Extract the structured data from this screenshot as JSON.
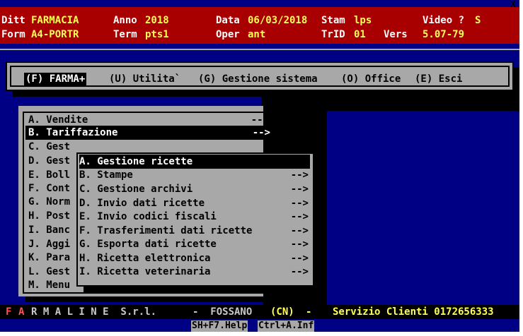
{
  "header": {
    "row1": {
      "ditt_label": "Ditt",
      "ditt_value": "FARMACIA",
      "anno_label": "Anno",
      "anno_value": "2018",
      "data_label": "Data",
      "data_value": "06/03/2018",
      "stam_label": "Stam",
      "stam_value": "lps",
      "video_label": "Video ?",
      "video_value": "S"
    },
    "row2": {
      "form_label": "Form",
      "form_value": "A4-PORTR",
      "term_label": "Term",
      "term_value": "pts1",
      "oper_label": "Oper",
      "oper_value": "ant",
      "trid_label": "TrID",
      "trid_value": "01",
      "vers_label": "Vers",
      "vers_value": "5.07-79"
    }
  },
  "close_glyph": "X",
  "menubar": {
    "items": [
      {
        "label": "(F) FARMA+",
        "selected": true
      },
      {
        "label": "(U) Utilita`",
        "selected": false
      },
      {
        "label": "(G) Gestione sistema",
        "selected": false
      },
      {
        "label": "(O) Office",
        "selected": false
      },
      {
        "label": "(E) Esci",
        "selected": false
      }
    ]
  },
  "menu1": {
    "items": [
      {
        "label": "A. Vendite",
        "arrow": "-->"
      },
      {
        "label": "B. Tariffazione",
        "arrow": "-->",
        "selected": true
      },
      {
        "label": "C. Gest",
        "arrow": ""
      },
      {
        "label": "D. Gest",
        "arrow": ""
      },
      {
        "label": "E. Boll",
        "arrow": ""
      },
      {
        "label": "F. Cont",
        "arrow": ""
      },
      {
        "label": "G. Norm",
        "arrow": ""
      },
      {
        "label": "H. Post",
        "arrow": ""
      },
      {
        "label": "I. Banc",
        "arrow": ""
      },
      {
        "label": "J. Aggi",
        "arrow": ""
      },
      {
        "label": "K. Para",
        "arrow": ""
      },
      {
        "label": "L. Gest",
        "arrow": ""
      },
      {
        "label": "M. Menu",
        "arrow": ""
      }
    ]
  },
  "menu2": {
    "items": [
      {
        "label": "A. Gestione ricette",
        "arrow": "",
        "selected": true
      },
      {
        "label": "B. Stampe",
        "arrow": "-->"
      },
      {
        "label": "C. Gestione archivi",
        "arrow": "-->"
      },
      {
        "label": "D. Invio dati ricette",
        "arrow": "-->"
      },
      {
        "label": "E. Invio codici fiscali",
        "arrow": "-->"
      },
      {
        "label": "F. Trasferimenti dati ricette",
        "arrow": "-->"
      },
      {
        "label": "G. Esporta dati ricette",
        "arrow": "-->"
      },
      {
        "label": "H. Ricetta elettronica",
        "arrow": "-->"
      },
      {
        "label": "I. Ricetta veterinaria",
        "arrow": "-->"
      }
    ]
  },
  "footer": {
    "brand_f": "F",
    "brand_a": "A",
    "brand_rest": "R M A L I N E  S.r.l.",
    "city": "-  FOSSANO",
    "province": "(CN)",
    "dash": "-",
    "service": "Servizio Clienti 0172656333"
  },
  "statusbar": {
    "help_key": "SH+F7.Help",
    "inf_key": "Ctrl+A.Inf"
  },
  "colors": {
    "background": "#000084",
    "header": "#a80000",
    "menu": "#a8a8a8",
    "highlight": "#000000",
    "value_text": "#ffff54"
  }
}
